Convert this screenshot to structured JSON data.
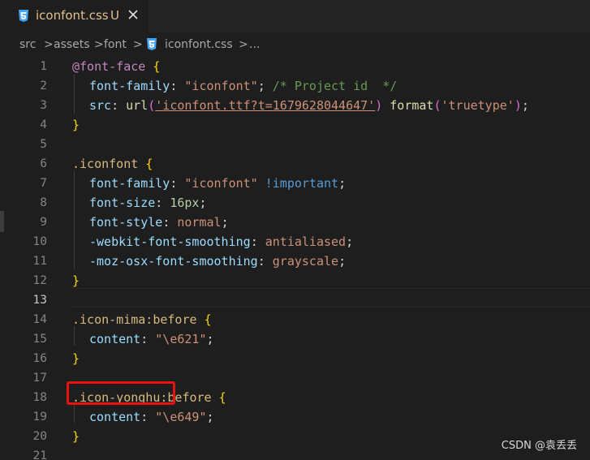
{
  "tab": {
    "icon": "css3-icon",
    "title": "iconfont.css",
    "status": "U",
    "close_icon": "close-icon"
  },
  "breadcrumb": {
    "items": [
      "src",
      "assets",
      "font",
      "iconfont.css",
      "..."
    ],
    "separator": ">"
  },
  "lines": [
    {
      "n": "1"
    },
    {
      "n": "2"
    },
    {
      "n": "3"
    },
    {
      "n": "4"
    },
    {
      "n": "5"
    },
    {
      "n": "6"
    },
    {
      "n": "7"
    },
    {
      "n": "8"
    },
    {
      "n": "9"
    },
    {
      "n": "10"
    },
    {
      "n": "11"
    },
    {
      "n": "12"
    },
    {
      "n": "13"
    },
    {
      "n": "14"
    },
    {
      "n": "15"
    },
    {
      "n": "16"
    },
    {
      "n": "17"
    },
    {
      "n": "18"
    },
    {
      "n": "19"
    },
    {
      "n": "20"
    },
    {
      "n": "21"
    }
  ],
  "code": {
    "l1": {
      "at": "@font-face",
      "brace": "{"
    },
    "l2": {
      "prop": "font-family",
      "colon": ": ",
      "str": "\"iconfont\"",
      "semi": "; ",
      "comment": "/* Project id  */"
    },
    "l3": {
      "prop": "src",
      "colon": ": ",
      "fn1": "url",
      "p1": "(",
      "str1": "'iconfont.ttf?t=1679628044647'",
      "p2": ")",
      "sp": " ",
      "fn2": "format",
      "p3": "(",
      "str2": "'truetype'",
      "p4": ")",
      "semi": ";"
    },
    "l4": {
      "brace": "}"
    },
    "l6": {
      "sel": ".iconfont",
      "brace": "{"
    },
    "l7": {
      "prop": "font-family",
      "colon": ": ",
      "str": "\"iconfont\"",
      "imp": "!important",
      "semi": ";"
    },
    "l8": {
      "prop": "font-size",
      "colon": ": ",
      "num": "16px",
      "semi": ";"
    },
    "l9": {
      "prop": "font-style",
      "colon": ": ",
      "val": "normal",
      "semi": ";"
    },
    "l10": {
      "prop": "-webkit-font-smoothing",
      "colon": ": ",
      "val": "antialiased",
      "semi": ";"
    },
    "l11": {
      "prop": "-moz-osx-font-smoothing",
      "colon": ": ",
      "val": "grayscale",
      "semi": ";"
    },
    "l12": {
      "brace": "}"
    },
    "l14": {
      "sel": ".icon-mima:before",
      "brace": "{"
    },
    "l15": {
      "prop": "content",
      "colon": ": ",
      "str": "\"\\e621\"",
      "semi": ";"
    },
    "l16": {
      "brace": "}"
    },
    "l18": {
      "sel": ".icon-yonghu:before",
      "brace": "{"
    },
    "l19": {
      "prop": "content",
      "colon": ": ",
      "str": "\"\\e649\"",
      "semi": ";"
    },
    "l20": {
      "brace": "}"
    }
  },
  "watermark": "CSDN @袁丢丢",
  "colors": {
    "background": "#1e1e1e",
    "highlight_box": "#e8130f",
    "modified_text": "#e2c08d"
  }
}
